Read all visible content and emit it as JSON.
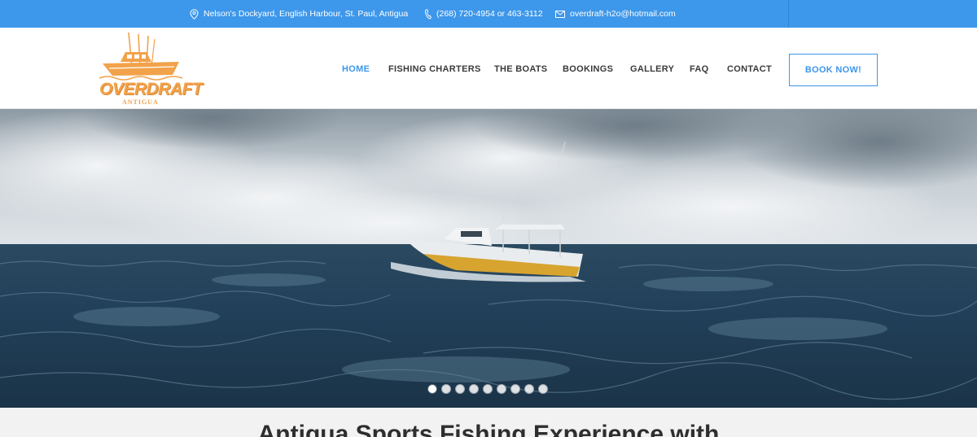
{
  "topbar": {
    "address": "Nelson's Dockyard, English Harbour, St. Paul, Antigua",
    "phone": "(268) 720-4954 or 463-3112",
    "email": "overdraft-h2o@hotmail.com",
    "icons": [
      "location-pin-icon",
      "phone-icon",
      "envelope-icon"
    ]
  },
  "logo": {
    "title": "OVERDRAFT",
    "subtitle": "ANTIGUA"
  },
  "nav": {
    "items": [
      {
        "label": "HOME",
        "active": true
      },
      {
        "label": "FISHING CHARTERS",
        "active": false
      },
      {
        "label": "THE BOATS",
        "active": false
      },
      {
        "label": "BOOKINGS",
        "active": false
      },
      {
        "label": "GALLERY",
        "active": false
      },
      {
        "label": "FAQ",
        "active": false
      },
      {
        "label": "CONTACT",
        "active": false
      }
    ],
    "cta": "BOOK NOW!"
  },
  "hero": {
    "slide_count": 9,
    "active_slide": 1
  },
  "content": {
    "headline": "Antigua Sports Fishing Experience with"
  },
  "colors": {
    "accent": "#3d97ea",
    "logo_orange": "#f2a24a",
    "nav_text": "#3a3a3a"
  }
}
